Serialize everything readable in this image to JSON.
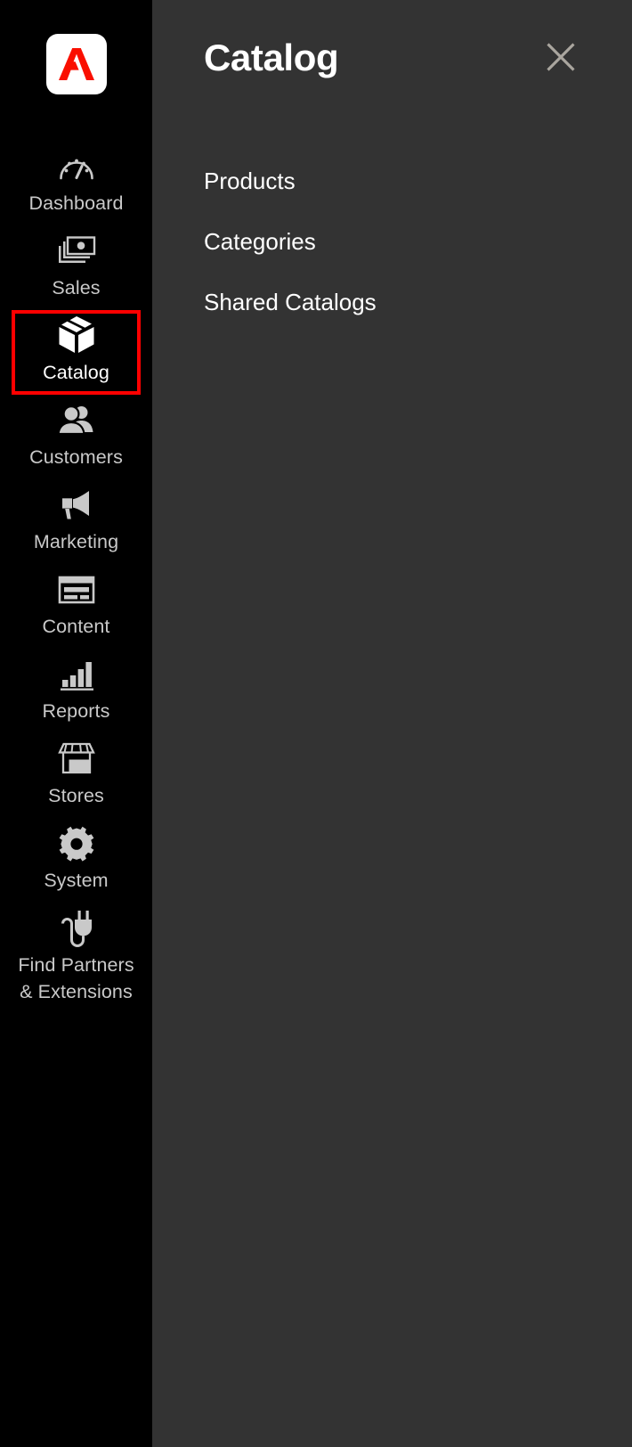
{
  "sidebar": {
    "logo": {
      "icon": "adobe-logo-icon",
      "background": "#ffffff",
      "mark_color": "#fa0f00"
    },
    "items": [
      {
        "label": "Dashboard",
        "icon": "gauge-icon",
        "active": false
      },
      {
        "label": "Sales",
        "icon": "money-stack-icon",
        "active": false
      },
      {
        "label": "Catalog",
        "icon": "box-icon",
        "active": true
      },
      {
        "label": "Customers",
        "icon": "people-icon",
        "active": false
      },
      {
        "label": "Marketing",
        "icon": "megaphone-icon",
        "active": false
      },
      {
        "label": "Content",
        "icon": "layout-window-icon",
        "active": false
      },
      {
        "label": "Reports",
        "icon": "bar-chart-icon",
        "active": false
      },
      {
        "label": "Stores",
        "icon": "storefront-icon",
        "active": false
      },
      {
        "label": "System",
        "icon": "gear-icon",
        "active": false
      },
      {
        "label": "Find Partners\n& Extensions",
        "icon": "plug-icon",
        "active": false
      }
    ],
    "highlight_color": "#ff0000",
    "background": "#000000",
    "label_color": "#c9c9c9"
  },
  "panel": {
    "title": "Catalog",
    "background": "#333333",
    "close": {
      "icon": "close-icon",
      "label": "Close",
      "color": "#aaa69f"
    },
    "menu": [
      {
        "label": "Products"
      },
      {
        "label": "Categories"
      },
      {
        "label": "Shared Catalogs"
      }
    ]
  }
}
